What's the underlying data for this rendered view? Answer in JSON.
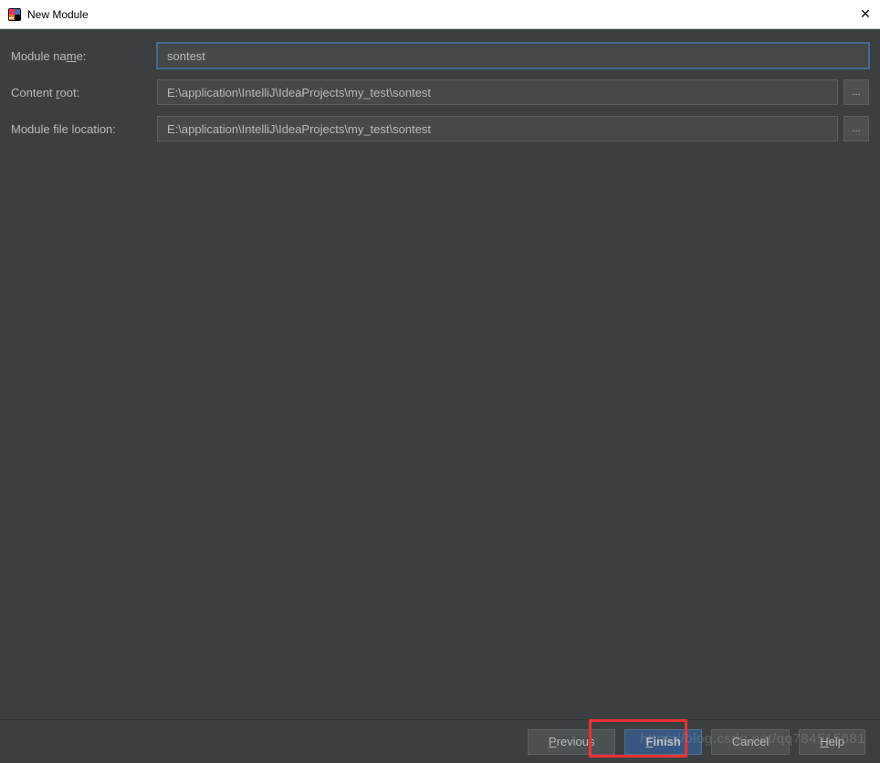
{
  "titlebar": {
    "title": "New Module",
    "close_symbol": "✕"
  },
  "form": {
    "module_name": {
      "label_pre": "Module na",
      "label_u": "m",
      "label_post": "e:",
      "value": "sontest"
    },
    "content_root": {
      "label_pre": "Content ",
      "label_u": "r",
      "label_post": "oot:",
      "value": "E:\\application\\IntelliJ\\IdeaProjects\\my_test\\sontest",
      "browse": "..."
    },
    "module_file_location": {
      "label": "Module file location:",
      "value": "E:\\application\\IntelliJ\\IdeaProjects\\my_test\\sontest",
      "browse": "..."
    }
  },
  "buttons": {
    "previous_u": "P",
    "previous_rest": "revious",
    "finish_u": "F",
    "finish_rest": "inish",
    "cancel": "Cancel",
    "help_pre": "",
    "help_u": "H",
    "help_post": "elp"
  },
  "watermark": "https://blog.csdn.net/qq784515681"
}
